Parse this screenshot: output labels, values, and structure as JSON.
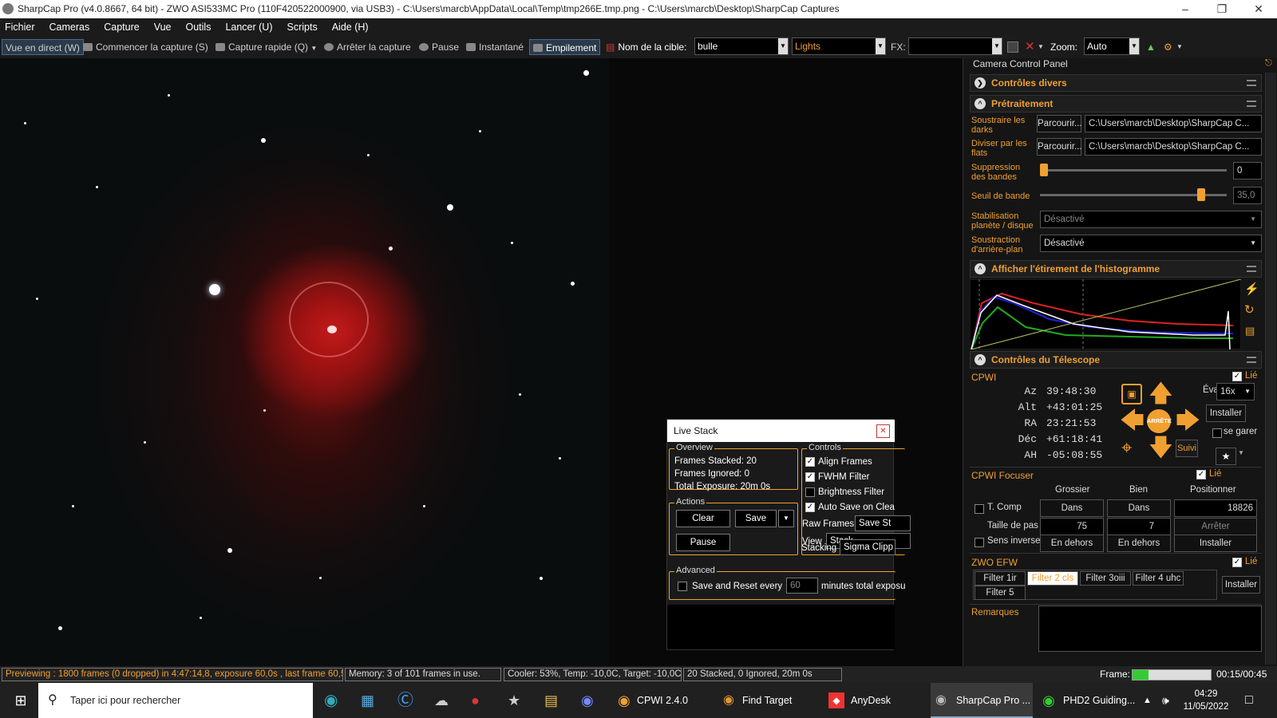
{
  "window": {
    "title": "SharpCap Pro (v4.0.8667, 64 bit) - ZWO ASI533MC Pro (110F420522000900, via USB3) - C:\\Users\\marcb\\AppData\\Local\\Temp\\tmp266E.tmp.png - C:\\Users\\marcb\\Desktop\\SharpCap Captures"
  },
  "menu": [
    "Fichier",
    "Cameras",
    "Capture",
    "Vue",
    "Outils",
    "Lancer (U)",
    "Scripts",
    "Aide (H)"
  ],
  "toolbar": {
    "live": "Vue en direct (W)",
    "start": "Commencer la capture (S)",
    "quick": "Capture rapide (Q)",
    "stop": "Arrêter la capture",
    "pause": "Pause",
    "snapshot": "Instantané",
    "stack": "Empilement",
    "target_label": "Nom de la cible:",
    "target_value": "bulle",
    "frame_type": "Lights",
    "fx_label": "FX:",
    "fx_value": "",
    "zoom_label": "Zoom:",
    "zoom_value": "Auto"
  },
  "panel": {
    "title": "Camera Control Panel",
    "misc": "Contrôles divers",
    "pre": {
      "title": "Prétraitement",
      "darks_label": "Soustraire les darks",
      "darks_browse": "Parcourir...",
      "darks_path": "C:\\Users\\marcb\\Desktop\\SharpCap C...",
      "flats_label": "Diviser par les flats",
      "flats_browse": "Parcourir...",
      "flats_path": "C:\\Users\\marcb\\Desktop\\SharpCap C...",
      "band_label": "Suppression des bandes",
      "band_value": "0",
      "band_level": 0.0,
      "thresh_label": "Seuil de bande",
      "thresh_value": "35,0",
      "thresh_level": 0.88,
      "stab_label": "Stabilisation planète / disque",
      "stab_value": "Désactivé",
      "bg_label": "Soustraction d'arrière-plan",
      "bg_value": "Désactivé"
    },
    "histo": {
      "title": "Afficher l'étirement de l'histogramme"
    },
    "scope": {
      "title": "Contrôles du Télescope",
      "mount": "CPWI",
      "linked": "Lié",
      "coords": [
        {
          "k": "Az",
          "v": "39:48:30"
        },
        {
          "k": "Alt",
          "v": "+43:01:25"
        },
        {
          "k": "RA",
          "v": "23:21:53"
        },
        {
          "k": "Déc",
          "v": "+61:18:41"
        },
        {
          "k": "AH",
          "v": "-05:08:55"
        }
      ],
      "rate_label": "Évaluer:",
      "rate_value": "16x",
      "install": "Installer",
      "park": "se garer",
      "stop": "ARRÊTE",
      "track": "Suivi"
    },
    "focuser": {
      "title": "CPWI Focuser",
      "linked": "Lié",
      "col_coarse": "Grossier",
      "col_fine": "Bien",
      "col_pos": "Positionner",
      "tcomp": "T. Comp",
      "in1": "Dans",
      "in2": "Dans",
      "position": "18826",
      "step_label": "Taille de pas",
      "step_coarse": "75",
      "step_fine": "7",
      "stop": "Arrêter",
      "reverse": "Sens inverse",
      "out1": "En dehors",
      "out2": "En dehors",
      "install": "Installer"
    },
    "efw": {
      "title": "ZWO EFW",
      "linked": "Lié",
      "filters": [
        "Filter 1ir",
        "Filter 2 cls",
        "Filter 3oiii",
        "Filter 4 uhc",
        "Filter 5"
      ],
      "install": "Installer"
    },
    "notes": "Remarques"
  },
  "livestack": {
    "title": "Live Stack",
    "overview": "Overview",
    "frames_stacked": "Frames Stacked: 20",
    "frames_ignored": "Frames Ignored:  0",
    "total_exposure": "Total Exposure:  20m 0s",
    "actions": "Actions",
    "clear": "Clear",
    "save": "Save",
    "pause": "Pause",
    "controls": "Controls",
    "align": "Align Frames",
    "fwhm": "FWHM Filter",
    "brightness": "Brightness Filter",
    "autosave": "Auto Save on Clea",
    "raw_label": "Raw Frames",
    "raw_value": "Save St",
    "view_label": "View",
    "view_value": "Stack",
    "stacking_label": "Stacking",
    "stacking_value": "Sigma Clipp",
    "advanced": "Advanced",
    "save_reset": "Save and Reset every",
    "minutes": "60",
    "minutes_suffix": "minutes total exposu"
  },
  "status": {
    "preview": "Previewing : 1800 frames (0 dropped) in 4:47:14,8, exposure 60,0s , last frame 60,5",
    "memory": "Memory: 3 of 101 frames in use.",
    "cooler": "Cooler: 53%, Temp: -10,0C, Target: -10,0C",
    "stacked": "20 Stacked, 0 Ignored, 20m 0s",
    "frame_label": "Frame:",
    "frame_progress": 0.2,
    "time": "00:15/00:45"
  },
  "taskbar": {
    "search": "Taper ici pour rechercher",
    "apps": [
      "CPWI 2.4.0",
      "Find Target",
      "AnyDesk",
      "SharpCap Pro ...",
      "PHD2 Guiding..."
    ],
    "clock_time": "04:29",
    "clock_date": "11/05/2022"
  },
  "colors": {
    "accent": "#f0a030"
  }
}
